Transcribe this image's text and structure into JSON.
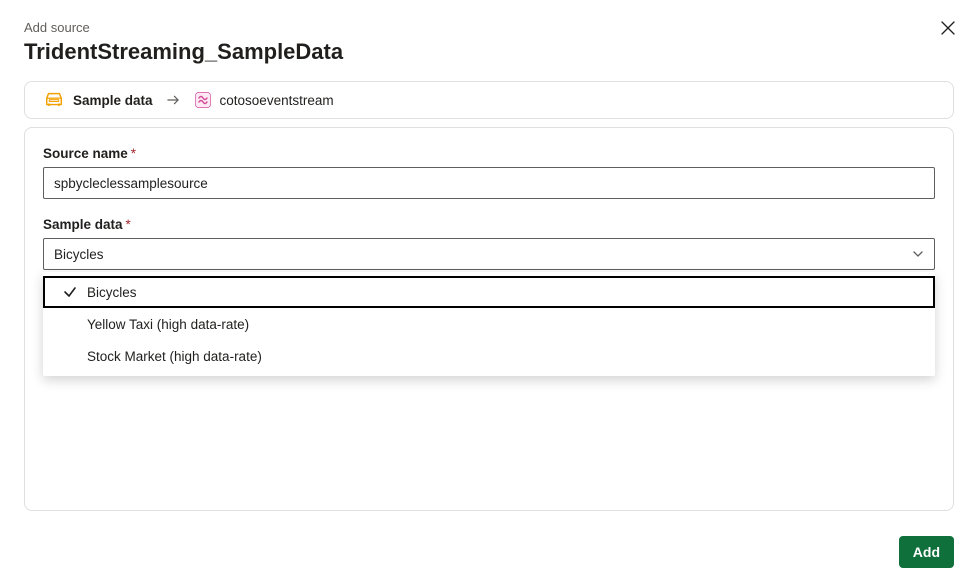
{
  "header": {
    "small_label": "Add source",
    "title": "TridentStreaming_SampleData"
  },
  "breadcrumb": {
    "source_type": "Sample data",
    "destination": "cotosoeventstream"
  },
  "form": {
    "source_name": {
      "label": "Source name",
      "required_mark": "*",
      "value": "spbycleclessamplesource"
    },
    "sample_data": {
      "label": "Sample data",
      "required_mark": "*",
      "selected": "Bicycles",
      "options": [
        {
          "label": "Bicycles",
          "selected": true
        },
        {
          "label": "Yellow Taxi (high data-rate)",
          "selected": false
        },
        {
          "label": "Stock Market (high data-rate)",
          "selected": false
        }
      ]
    }
  },
  "footer": {
    "add_button": "Add"
  }
}
